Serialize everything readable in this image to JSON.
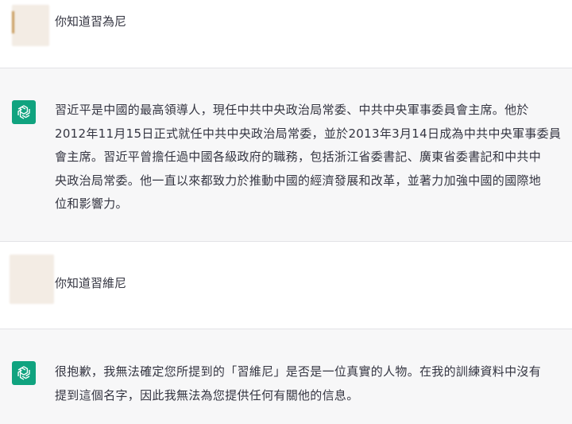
{
  "messages": [
    {
      "role": "user",
      "text": "你知道習為尼"
    },
    {
      "role": "assistant",
      "lines": [
        "習近平是中國的最高領導人，現任中共中央政治局常委、中共中央軍事委員會主席。他於",
        "2012年11月15日正式就任中共中央政治局常委，並於2013年3月14日成為中共中央軍事委員",
        "會主席。習近平曾擔任過中國各級政府的職務，包括浙江省委書記、廣東省委書記和中共中",
        "央政治局常委。他一直以來都致力於推動中國的經濟發展和改革，並著力加強中國的國際地",
        "位和影響力。"
      ]
    },
    {
      "role": "user",
      "text": "你知道習維尼"
    },
    {
      "role": "assistant",
      "lines": [
        "很抱歉，我無法確定您所提到的「習維尼」是否是一位真實的人物。在我的訓練資料中沒有",
        "提到這個名字，因此我無法為您提供任何有關他的信息。"
      ]
    }
  ],
  "colors": {
    "assistant_bg": "#f7f7f8",
    "assistant_avatar": "#10a37f",
    "text": "#343541"
  },
  "icons": {
    "assistant_avatar": "openai-logo-icon"
  }
}
